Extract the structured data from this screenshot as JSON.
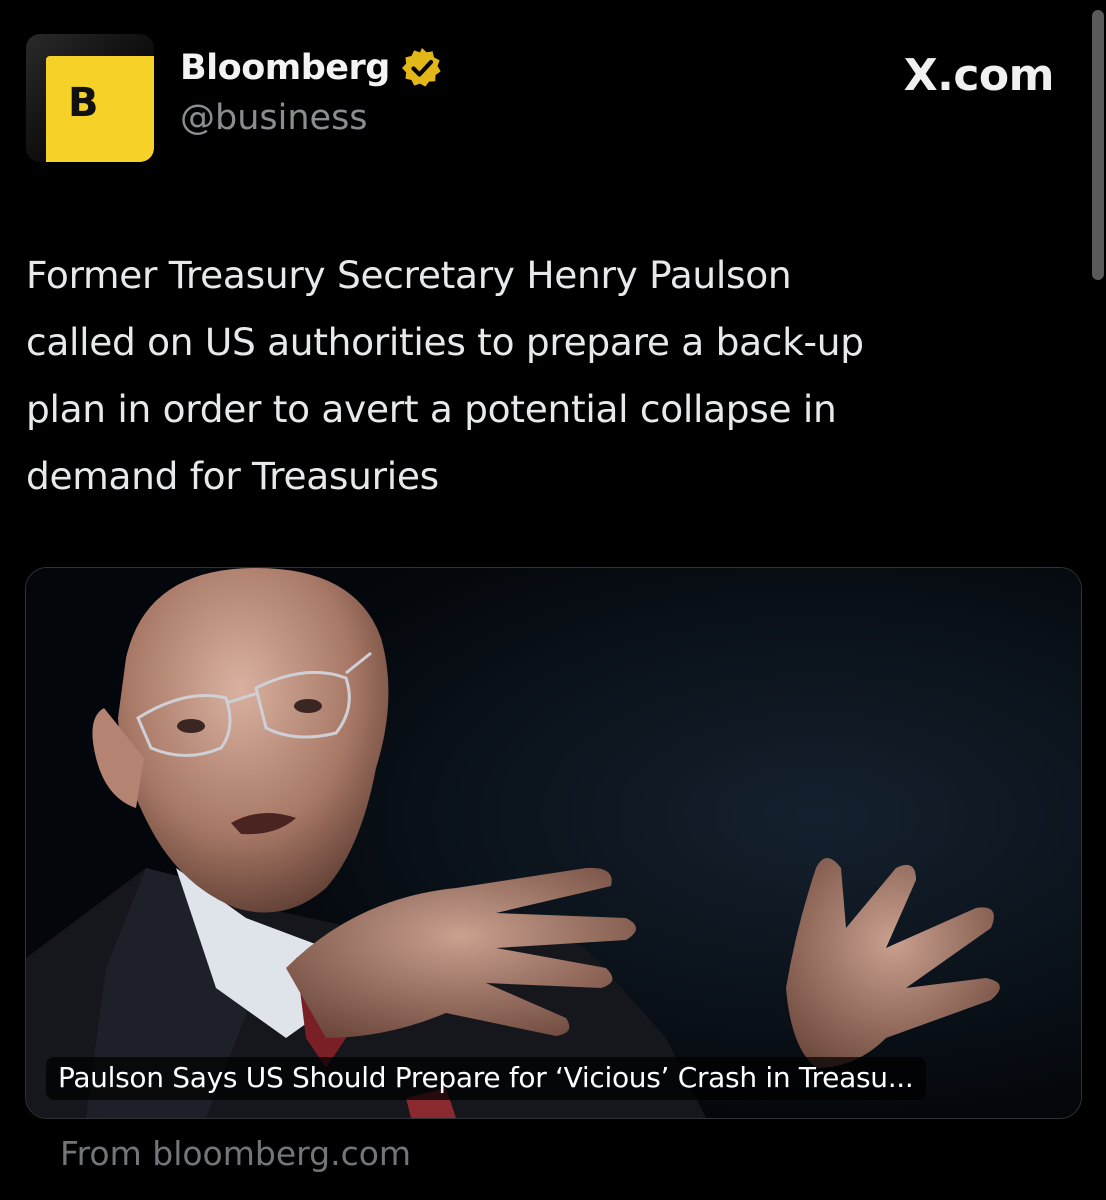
{
  "tweet": {
    "author": {
      "display_name": "Bloomberg",
      "handle": "@business",
      "avatar_letter": "B",
      "verified": true,
      "avatar_color": "#f6d229",
      "verified_color": "#e2b719"
    },
    "site_label": "X.com",
    "text": "Former Treasury Secretary Henry Paulson\ncalled on US authorities to prepare a back-up\nplan in order to avert a potential collapse in\ndemand for Treasuries",
    "card": {
      "title": "Paulson Says US Should Prepare for ‘Vicious’ Crash in Treasu...",
      "image_subject": "photo-of-man-speaking-with-hands-raised"
    },
    "source": "From bloomberg.com"
  }
}
